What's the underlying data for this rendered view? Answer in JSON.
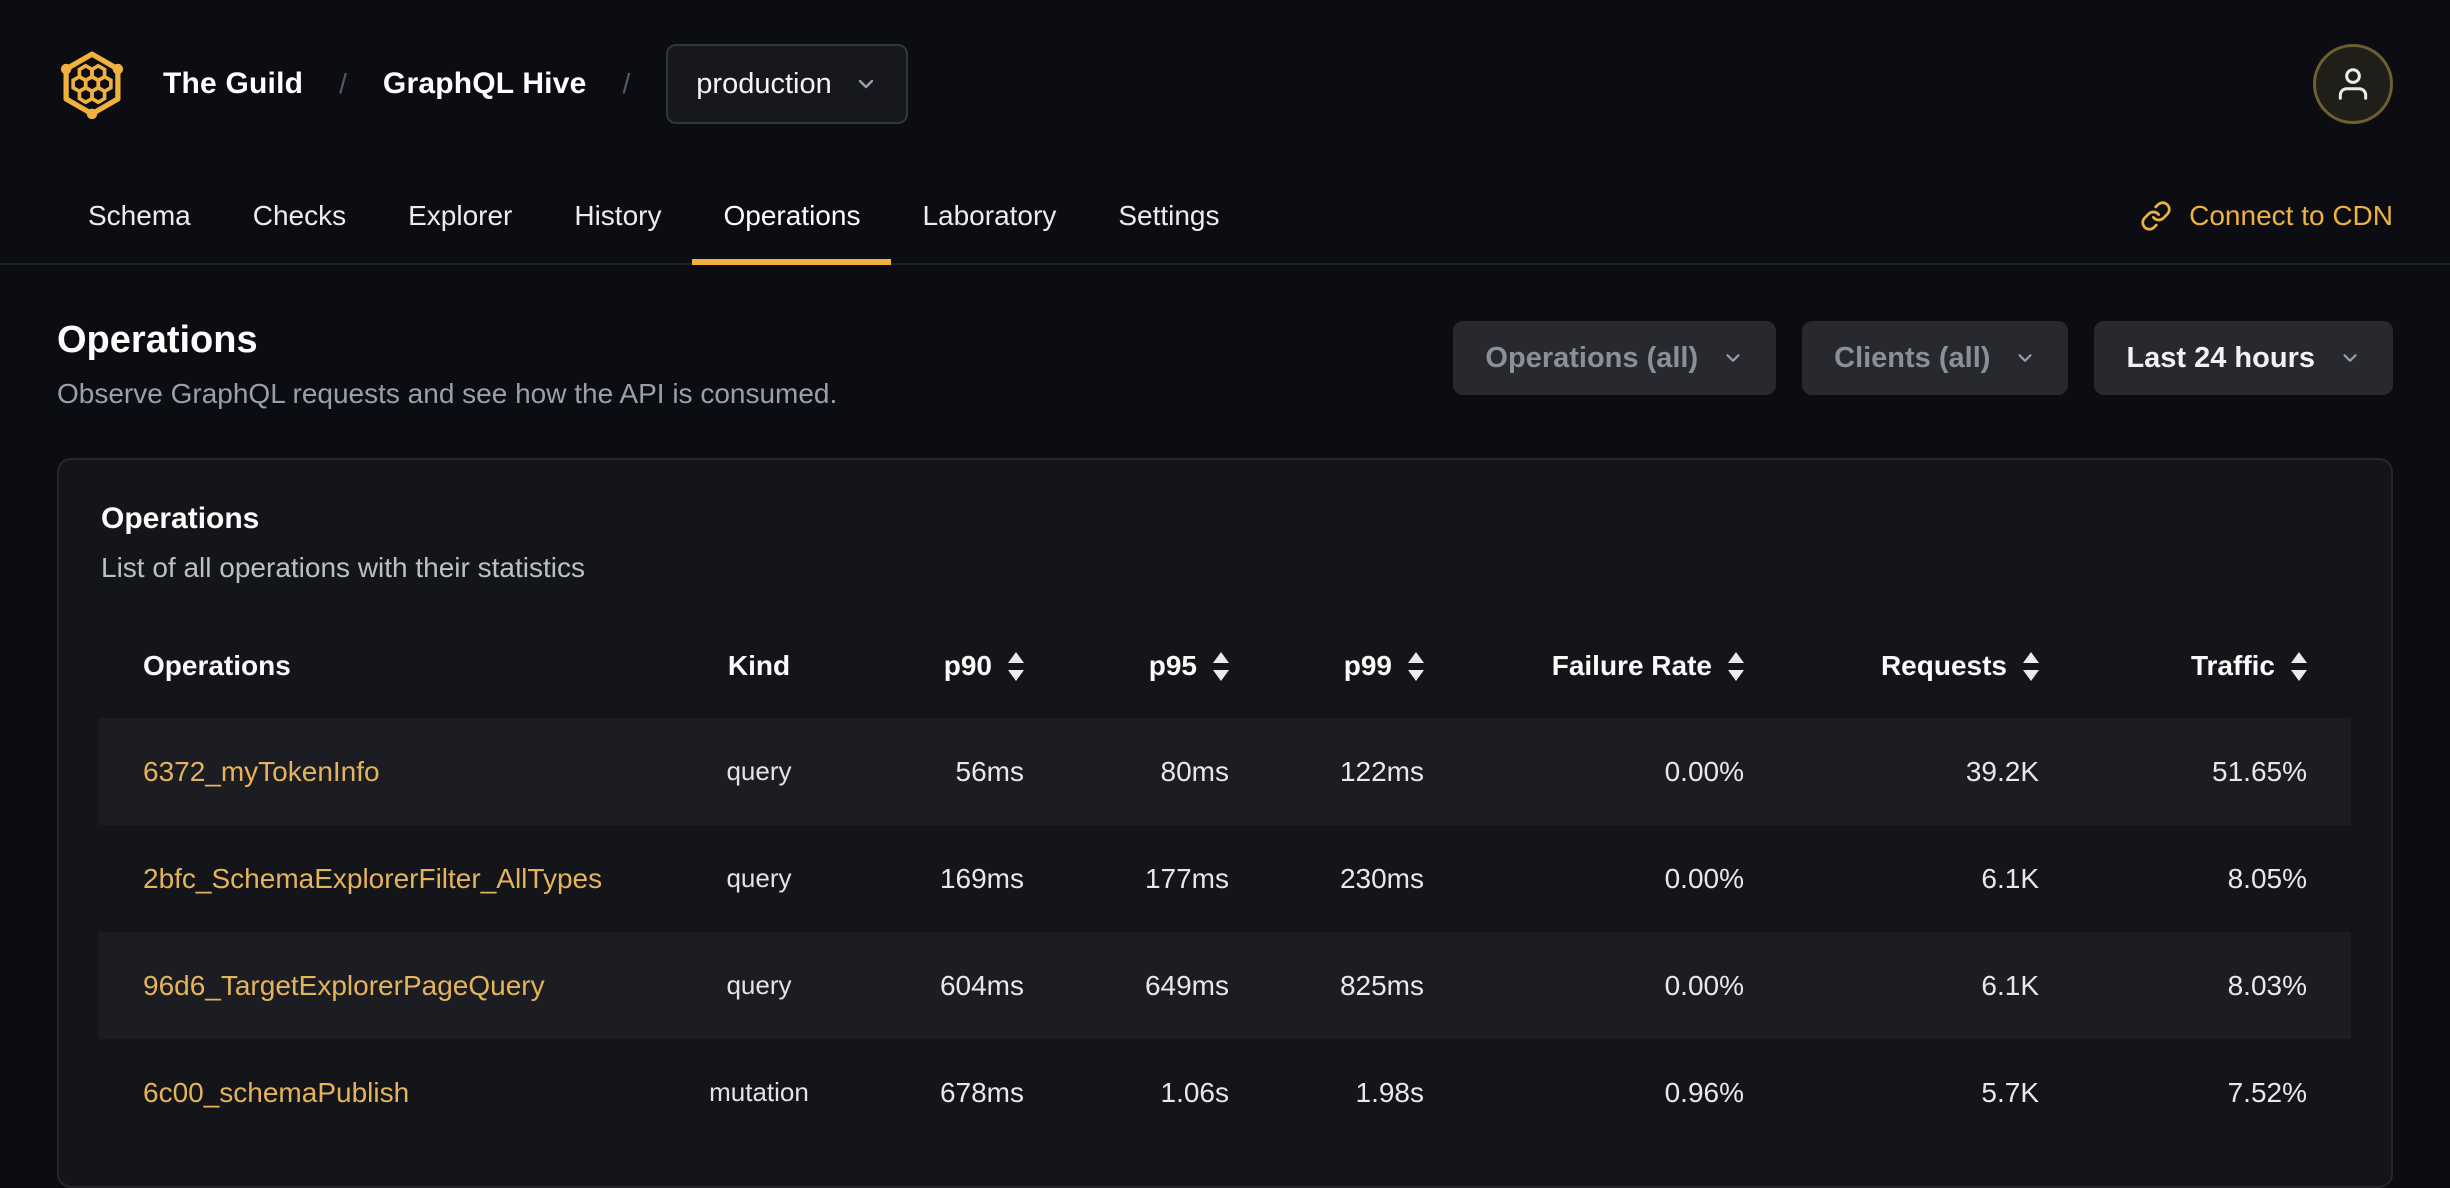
{
  "header": {
    "org": "The Guild",
    "project": "GraphQL Hive",
    "separator": "/",
    "target_selector": {
      "value": "production"
    }
  },
  "nav": {
    "tabs": [
      {
        "label": "Schema",
        "active": false
      },
      {
        "label": "Checks",
        "active": false
      },
      {
        "label": "Explorer",
        "active": false
      },
      {
        "label": "History",
        "active": false
      },
      {
        "label": "Operations",
        "active": true
      },
      {
        "label": "Laboratory",
        "active": false
      },
      {
        "label": "Settings",
        "active": false
      }
    ],
    "cdn_link": "Connect to CDN"
  },
  "page": {
    "title": "Operations",
    "subtitle": "Observe GraphQL requests and see how the API is consumed."
  },
  "filters": {
    "operations": "Operations (all)",
    "clients": "Clients (all)",
    "period": "Last 24 hours"
  },
  "card": {
    "title": "Operations",
    "subtitle": "List of all operations with their statistics"
  },
  "table": {
    "columns": [
      {
        "label": "Operations",
        "sortable": false
      },
      {
        "label": "Kind",
        "sortable": false
      },
      {
        "label": "p90",
        "sortable": true
      },
      {
        "label": "p95",
        "sortable": true
      },
      {
        "label": "p99",
        "sortable": true
      },
      {
        "label": "Failure Rate",
        "sortable": true
      },
      {
        "label": "Requests",
        "sortable": true
      },
      {
        "label": "Traffic",
        "sortable": true
      }
    ],
    "rows": [
      {
        "name": "6372_myTokenInfo",
        "kind": "query",
        "p90": "56ms",
        "p95": "80ms",
        "p99": "122ms",
        "failure_rate": "0.00%",
        "requests": "39.2K",
        "traffic": "51.65%"
      },
      {
        "name": "2bfc_SchemaExplorerFilter_AllTypes",
        "kind": "query",
        "p90": "169ms",
        "p95": "177ms",
        "p99": "230ms",
        "failure_rate": "0.00%",
        "requests": "6.1K",
        "traffic": "8.05%"
      },
      {
        "name": "96d6_TargetExplorerPageQuery",
        "kind": "query",
        "p90": "604ms",
        "p95": "649ms",
        "p99": "825ms",
        "failure_rate": "0.00%",
        "requests": "6.1K",
        "traffic": "8.03%"
      },
      {
        "name": "6c00_schemaPublish",
        "kind": "mutation",
        "p90": "678ms",
        "p95": "1.06s",
        "p99": "1.98s",
        "failure_rate": "0.96%",
        "requests": "5.7K",
        "traffic": "7.52%"
      }
    ]
  },
  "icons": {
    "logo": "hive-honeycomb-icon",
    "avatar": "user-icon",
    "cdn": "link-icon",
    "dropdowns": "chevron-down-icon",
    "sort": "sort-arrows-icon"
  },
  "colors": {
    "accent": "#f0b13e",
    "link_gold": "#e5b35c",
    "background": "#0b0d12",
    "card_background": "#131519",
    "row_stripe": "#1c1d22"
  }
}
